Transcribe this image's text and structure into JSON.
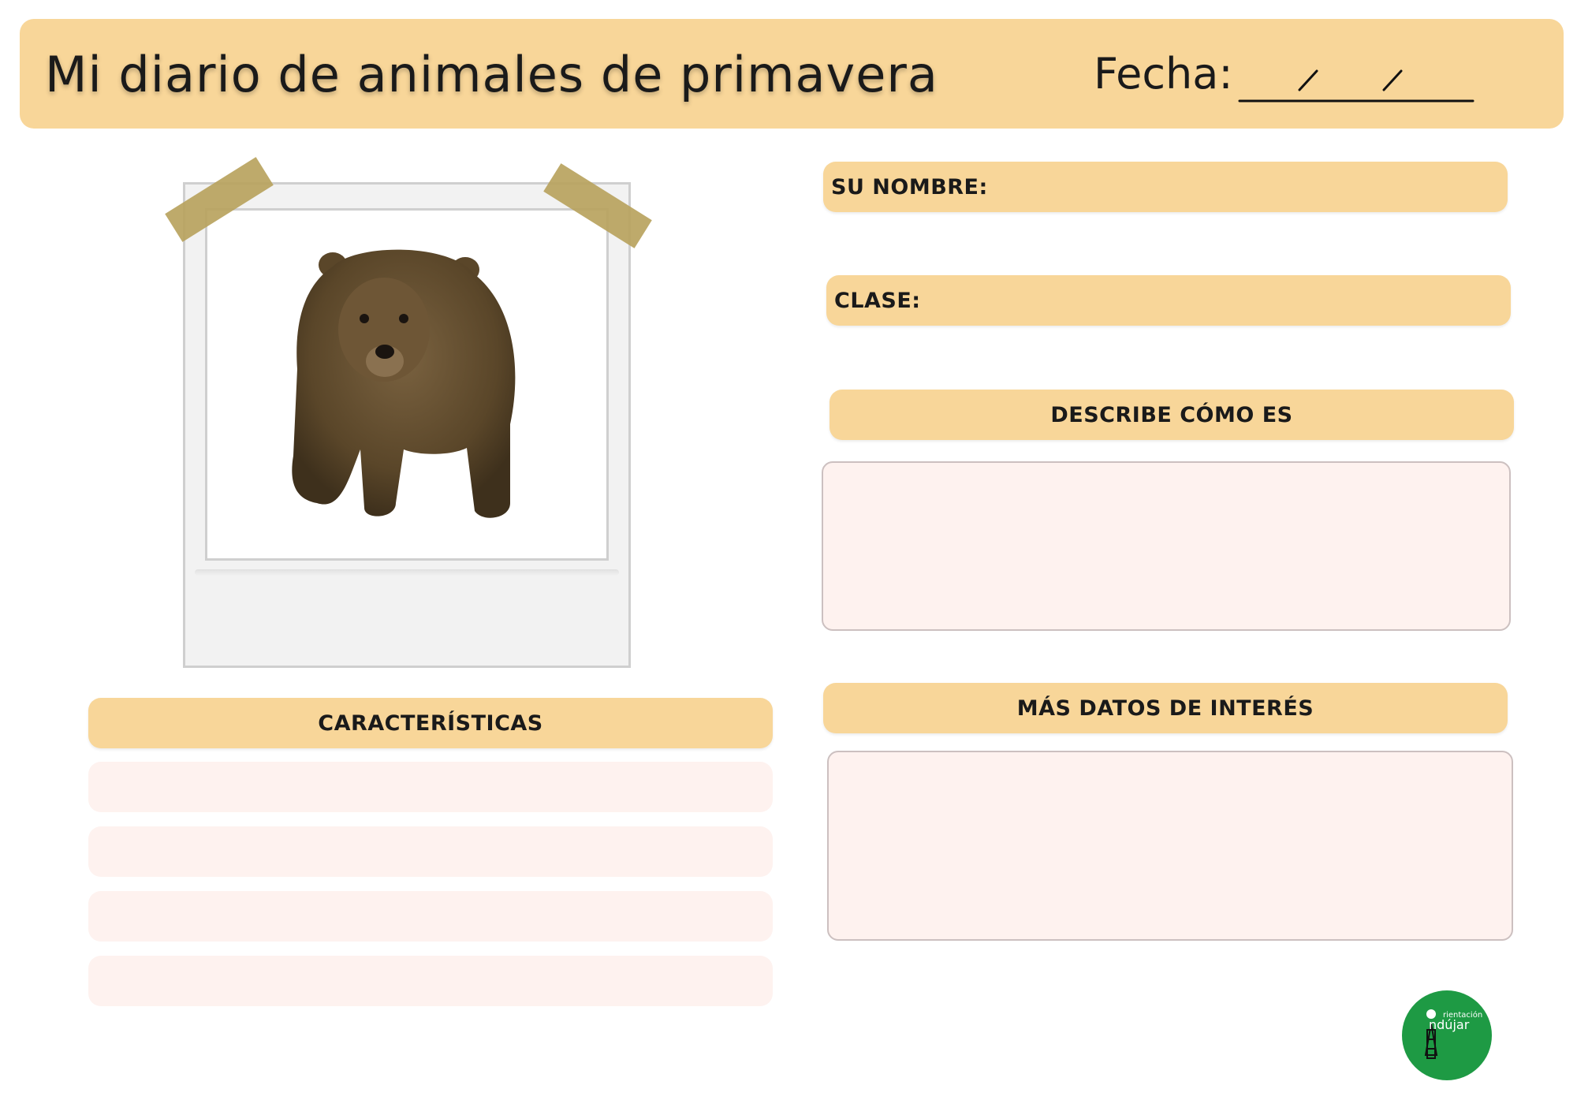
{
  "header": {
    "title": "Mi diario de animales de primavera",
    "date_label": "Fecha:"
  },
  "fields": {
    "name_label": "SU NOMBRE:",
    "class_label": "CLASE:",
    "describe_label": "DESCRIBE CÓMO ES",
    "more_data_label": "MÁS DATOS DE INTERÉS",
    "characteristics_label": "CARACTERÍSTICAS"
  },
  "logo": {
    "text_top": "rientación",
    "text_main": "ndújar",
    "color": "#1e9a44"
  },
  "colors": {
    "accent": "#f8d699",
    "field_bg": "#fef2ef"
  }
}
